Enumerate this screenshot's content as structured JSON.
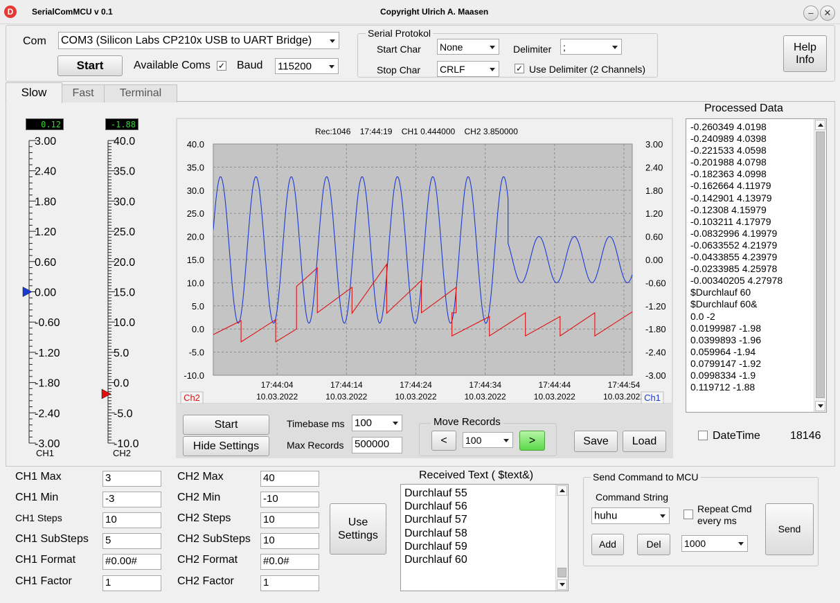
{
  "window": {
    "title": "SerialComMCU   v 0.1",
    "copyright": "Copyright Ulrich A. Maasen"
  },
  "connection": {
    "com_label": "Com",
    "com_value": "COM3 (Silicon Labs CP210x USB to UART Bridge)",
    "start_label": "Start",
    "available_coms_label": "Available Coms",
    "available_coms_checked": "✓",
    "baud_label": "Baud",
    "baud_value": "115200"
  },
  "protocol": {
    "title": "Serial Protokol",
    "start_char_label": "Start Char",
    "start_char_value": "None",
    "stop_char_label": "Stop Char",
    "stop_char_value": "CRLF",
    "delimiter_label": "Delimiter",
    "delimiter_value": ";",
    "use_delimiter_label": "Use Delimiter (2 Channels)",
    "use_delimiter_checked": "✓"
  },
  "help_button": {
    "line1": "Help",
    "line2": "Info"
  },
  "tabs": [
    {
      "label": "Slow"
    },
    {
      "label": "Fast"
    },
    {
      "label": "Terminal"
    }
  ],
  "gauges": {
    "ch1": {
      "value": "0.12",
      "label": "CH1",
      "ticks": [
        "3.00",
        "2.40",
        "1.80",
        "1.20",
        "0.60",
        "0.00",
        "-0.60",
        "-1.20",
        "-1.80",
        "-2.40",
        "-3.00"
      ],
      "pointer": 0.0,
      "color": "#1a3ad6"
    },
    "ch2": {
      "value": "-1.88",
      "label": "CH2",
      "ticks": [
        "40.0",
        "35.0",
        "30.0",
        "25.0",
        "20.0",
        "15.0",
        "10.0",
        "5.0",
        "0.0",
        "-5.0",
        "-10.0"
      ],
      "pointer": -1.88,
      "color": "#e01010"
    }
  },
  "chart_header": {
    "rec": "Rec:1046",
    "time": "17:44:19",
    "ch1_text": "CH1  0.444000",
    "ch2_text": "CH2  3.850000"
  },
  "chart_data": {
    "type": "line",
    "left_axis": {
      "ylim": [
        -10,
        40
      ],
      "ticks": [
        "40.0",
        "35.0",
        "30.0",
        "25.0",
        "20.0",
        "15.0",
        "10.0",
        "5.0",
        "0.0",
        "-5.0",
        "-10.0"
      ],
      "label": "Ch2",
      "color": "#e01010"
    },
    "right_axis": {
      "ylim": [
        -3,
        3
      ],
      "ticks": [
        "3.00",
        "2.40",
        "1.80",
        "1.20",
        "0.60",
        "0.00",
        "-0.60",
        "-1.20",
        "-1.80",
        "-2.40",
        "-3.00"
      ],
      "label": "Ch1",
      "color": "#1a3ad6"
    },
    "x_ticks": [
      {
        "time": "17:44:04",
        "date": "10.03.2022",
        "s": 4
      },
      {
        "time": "17:44:14",
        "date": "10.03.2022",
        "s": 14
      },
      {
        "time": "17:44:24",
        "date": "10.03.2022",
        "s": 24
      },
      {
        "time": "17:44:34",
        "date": "10.03.2022",
        "s": 34
      },
      {
        "time": "17:44:44",
        "date": "10.03.2022",
        "s": 44
      },
      {
        "time": "17:44:54",
        "date": "10.03.2022",
        "s": 54
      }
    ],
    "xlim": [
      -5.2,
      55.2
    ],
    "grid": true,
    "series": [
      {
        "name": "Ch1",
        "axis": "right",
        "color": "#1a3ad6",
        "segments": [
          {
            "s_start": -5.2,
            "s_end": 37.3,
            "amplitude": 1.9,
            "center": 0.25,
            "period_s": 5.1,
            "phase_s": 0.95
          },
          {
            "s_start": 37.3,
            "s_end": 55.2,
            "amplitude": 0.6,
            "center": 0.0,
            "period_s": 5.1,
            "phase_s": 0.95
          }
        ]
      },
      {
        "name": "Ch2",
        "axis": "left",
        "color": "#e01010",
        "points": [
          [
            -5.2,
            -1.2
          ],
          [
            -1.2,
            1.8
          ],
          [
            -1.2,
            -2.8
          ],
          [
            3.8,
            2.0
          ],
          [
            3.8,
            -2.8
          ],
          [
            6.8,
            0.0
          ],
          [
            6.8,
            9.2
          ],
          [
            9.8,
            13.2
          ],
          [
            9.8,
            3.5
          ],
          [
            14.8,
            9.0
          ],
          [
            14.8,
            3.4
          ],
          [
            19.8,
            14.0
          ],
          [
            19.8,
            3.4
          ],
          [
            24.8,
            10.5
          ],
          [
            24.8,
            3.5
          ],
          [
            29.8,
            9.0
          ],
          [
            29.8,
            3.5
          ],
          [
            29.2,
            3.5
          ],
          [
            29.2,
            -1.5
          ],
          [
            34.6,
            2.7
          ],
          [
            34.6,
            -1.5
          ],
          [
            39.8,
            3.5
          ],
          [
            39.8,
            -1.5
          ],
          [
            44.8,
            2.7
          ],
          [
            44.8,
            -1.5
          ],
          [
            49.8,
            3.5
          ],
          [
            49.8,
            -1.5
          ],
          [
            55.2,
            3.7
          ]
        ]
      }
    ]
  },
  "chart_controls": {
    "start_label": "Start",
    "hide_settings_label": "Hide Settings",
    "timebase_label": "Timebase ms",
    "timebase_value": "100",
    "max_records_label": "Max Records",
    "max_records_value": "500000",
    "move_records_label": "Move Records",
    "prev_label": "<",
    "move_value": "100",
    "next_label": ">",
    "save_label": "Save",
    "load_label": "Load"
  },
  "processed": {
    "title": "Processed Data",
    "rows": [
      "-0.260349  4.0198",
      "-0.240989  4.0398",
      "-0.221533  4.0598",
      "-0.201988  4.0798",
      "-0.182363  4.0998",
      "-0.162664  4.11979",
      "-0.142901  4.13979",
      "-0.12308  4.15979",
      "-0.103211  4.17979",
      "-0.0832996  4.19979",
      "-0.0633552  4.21979",
      "-0.0433855  4.23979",
      "-0.0233985  4.25978",
      "-0.00340205  4.27978",
      "$Durchlauf 60",
      "$Durchlauf 60&",
      "0.0  -2",
      "0.0199987  -1.98",
      "0.0399893  -1.96",
      "0.059964  -1.94",
      "0.0799147  -1.92",
      "0.0998334  -1.9",
      "0.119712  -1.88"
    ],
    "datetime_label": "DateTime",
    "count": "18146"
  },
  "settings": {
    "ch1": [
      {
        "label": "CH1 Max",
        "value": "3"
      },
      {
        "label": "CH1 Min",
        "value": "-3"
      },
      {
        "label": "CH1 Steps",
        "value": "10"
      },
      {
        "label": "CH1 SubSteps",
        "value": "5"
      },
      {
        "label": "CH1 Format",
        "value": "#0.00#"
      },
      {
        "label": "CH1 Factor",
        "value": "1"
      }
    ],
    "ch2": [
      {
        "label": "CH2 Max",
        "value": "40"
      },
      {
        "label": "CH2 Min",
        "value": "-10"
      },
      {
        "label": "CH2 Steps",
        "value": "10"
      },
      {
        "label": "CH2 SubSteps",
        "value": "10"
      },
      {
        "label": "CH2 Format",
        "value": "#0.0#"
      },
      {
        "label": "CH2 Factor",
        "value": "1"
      }
    ],
    "use_settings_line1": "Use",
    "use_settings_line2": "Settings"
  },
  "received": {
    "title": "Received Text ( $text&)",
    "rows": [
      "Durchlauf 55",
      "Durchlauf 56",
      "Durchlauf 57",
      "Durchlauf 58",
      "Durchlauf 59",
      "Durchlauf 60"
    ]
  },
  "send": {
    "title": "Send Command to MCU",
    "command_label": "Command String",
    "command_value": "huhu",
    "repeat_line1": "Repeat Cmd",
    "repeat_line2": "every ms",
    "add_label": "Add",
    "del_label": "Del",
    "repeat_value": "1000",
    "send_label": "Send"
  }
}
